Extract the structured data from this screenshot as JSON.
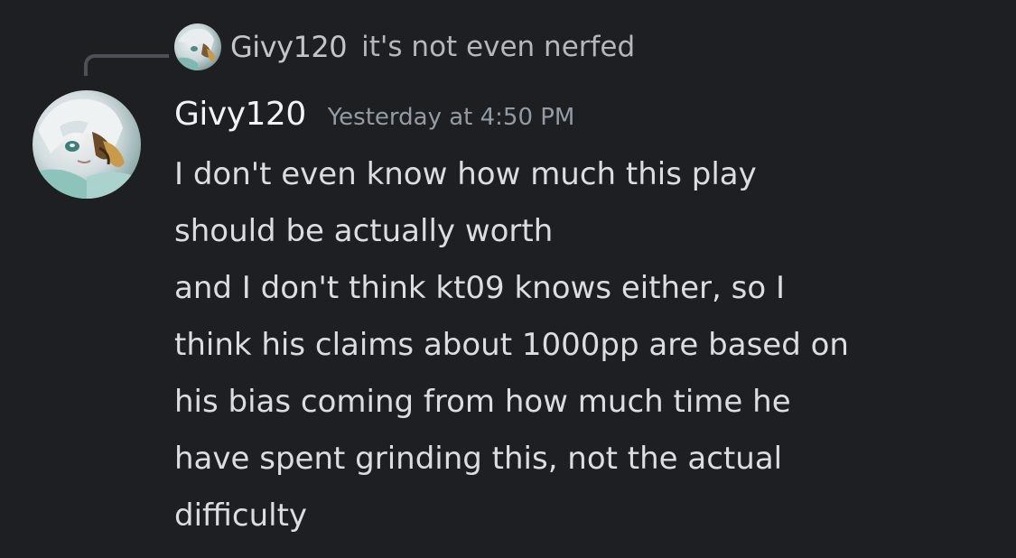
{
  "reply": {
    "author": "Givy120",
    "text": "it's not even nerfed"
  },
  "message": {
    "author": "Givy120",
    "timestamp": "Yesterday at 4:50 PM",
    "lines": [
      "I don't even know how much this play",
      "should be actually worth",
      "and I don't think kt09 knows either, so I",
      "think his claims about 1000pp are based on",
      "his bias coming from how much time he",
      "have spent grinding this, not the actual",
      "difficulty"
    ]
  },
  "colors": {
    "background": "#1e1f22",
    "author": "#f2f3f5",
    "timestamp": "#949ba4",
    "body_text": "#dbdee1",
    "reply_spine": "#4e5058"
  }
}
